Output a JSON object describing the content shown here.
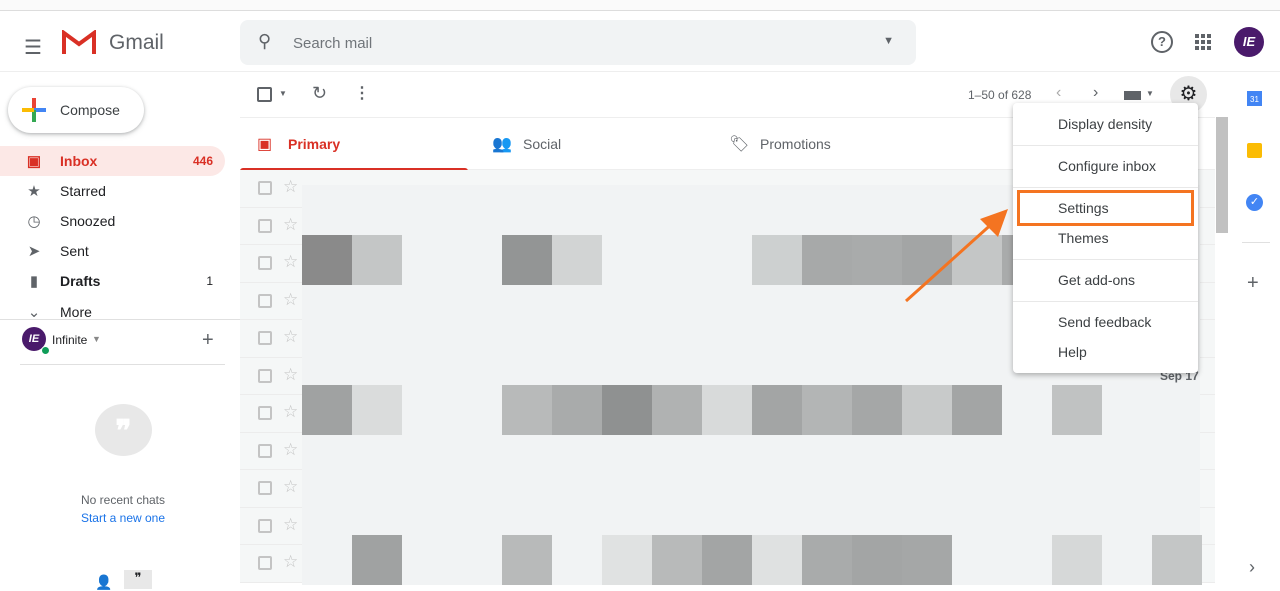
{
  "header": {
    "app_name": "Gmail",
    "search_placeholder": "Search mail",
    "avatar_initials": "IE"
  },
  "sidebar": {
    "compose_label": "Compose",
    "items": [
      {
        "label": "Inbox",
        "count": "446",
        "icon": "inbox-icon",
        "active": true
      },
      {
        "label": "Starred",
        "count": "",
        "icon": "star-icon"
      },
      {
        "label": "Snoozed",
        "count": "",
        "icon": "clock-icon"
      },
      {
        "label": "Sent",
        "count": "",
        "icon": "send-icon"
      },
      {
        "label": "Drafts",
        "count": "1",
        "icon": "draft-icon"
      },
      {
        "label": "More",
        "count": "",
        "icon": "chevron-down-icon"
      }
    ],
    "hangouts_user": "Infinite",
    "no_chats": "No recent chats",
    "start_new": "Start a new one"
  },
  "toolbar": {
    "pagination": "1–50 of 628"
  },
  "tabs": [
    {
      "label": "Primary"
    },
    {
      "label": "Social"
    },
    {
      "label": "Promotions"
    }
  ],
  "rows": {
    "date_visible": "Sep 17"
  },
  "settings_menu": {
    "items": [
      "Display density",
      "Configure inbox",
      "Settings",
      "Themes",
      "Get add-ons",
      "Send feedback",
      "Help"
    ],
    "highlighted": "Settings"
  },
  "colors": {
    "accent": "#d93025",
    "highlight": "#f47421"
  }
}
